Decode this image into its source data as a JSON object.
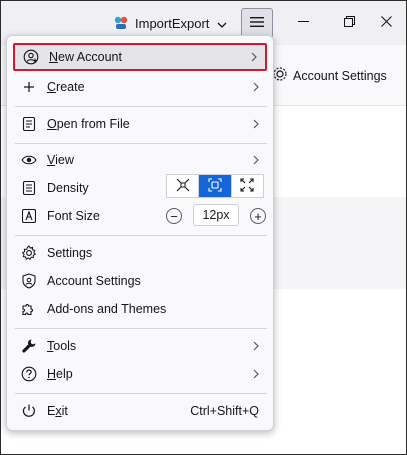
{
  "titlebar": {
    "profile_name": "ImportExport"
  },
  "background": {
    "account_settings": "Account Settings"
  },
  "menu": {
    "items": [
      {
        "label": "New Account",
        "mnemonic": "N",
        "rest": "ew Account",
        "has_arrow": true
      },
      {
        "label": "Create",
        "mnemonic": "C",
        "rest": "reate",
        "has_arrow": true
      },
      {
        "label": "Open from File",
        "mnemonic": "O",
        "rest": "pen from File",
        "has_arrow": true
      },
      {
        "label": "View",
        "mnemonic": "V",
        "rest": "iew",
        "has_arrow": true
      },
      {
        "label": "Density"
      },
      {
        "label": "Font Size"
      },
      {
        "label": "Settings"
      },
      {
        "label": "Account Settings"
      },
      {
        "label": "Add-ons and Themes"
      },
      {
        "label": "Tools",
        "mnemonic": "T",
        "rest": "ools",
        "has_arrow": true
      },
      {
        "label": "Help",
        "mnemonic": "H",
        "rest": "elp",
        "has_arrow": true
      },
      {
        "label": "Exit",
        "mnemonic": "x",
        "pre": "E",
        "rest": "it",
        "shortcut": "Ctrl+Shift+Q"
      }
    ],
    "density": {
      "selected": "normal",
      "options": [
        "compact",
        "normal",
        "touch"
      ]
    },
    "font_size": {
      "value": "12px",
      "minus": "−",
      "plus": "+"
    }
  },
  "colors": {
    "accent": "#1566d6",
    "highlight_border": "#d7172f"
  }
}
